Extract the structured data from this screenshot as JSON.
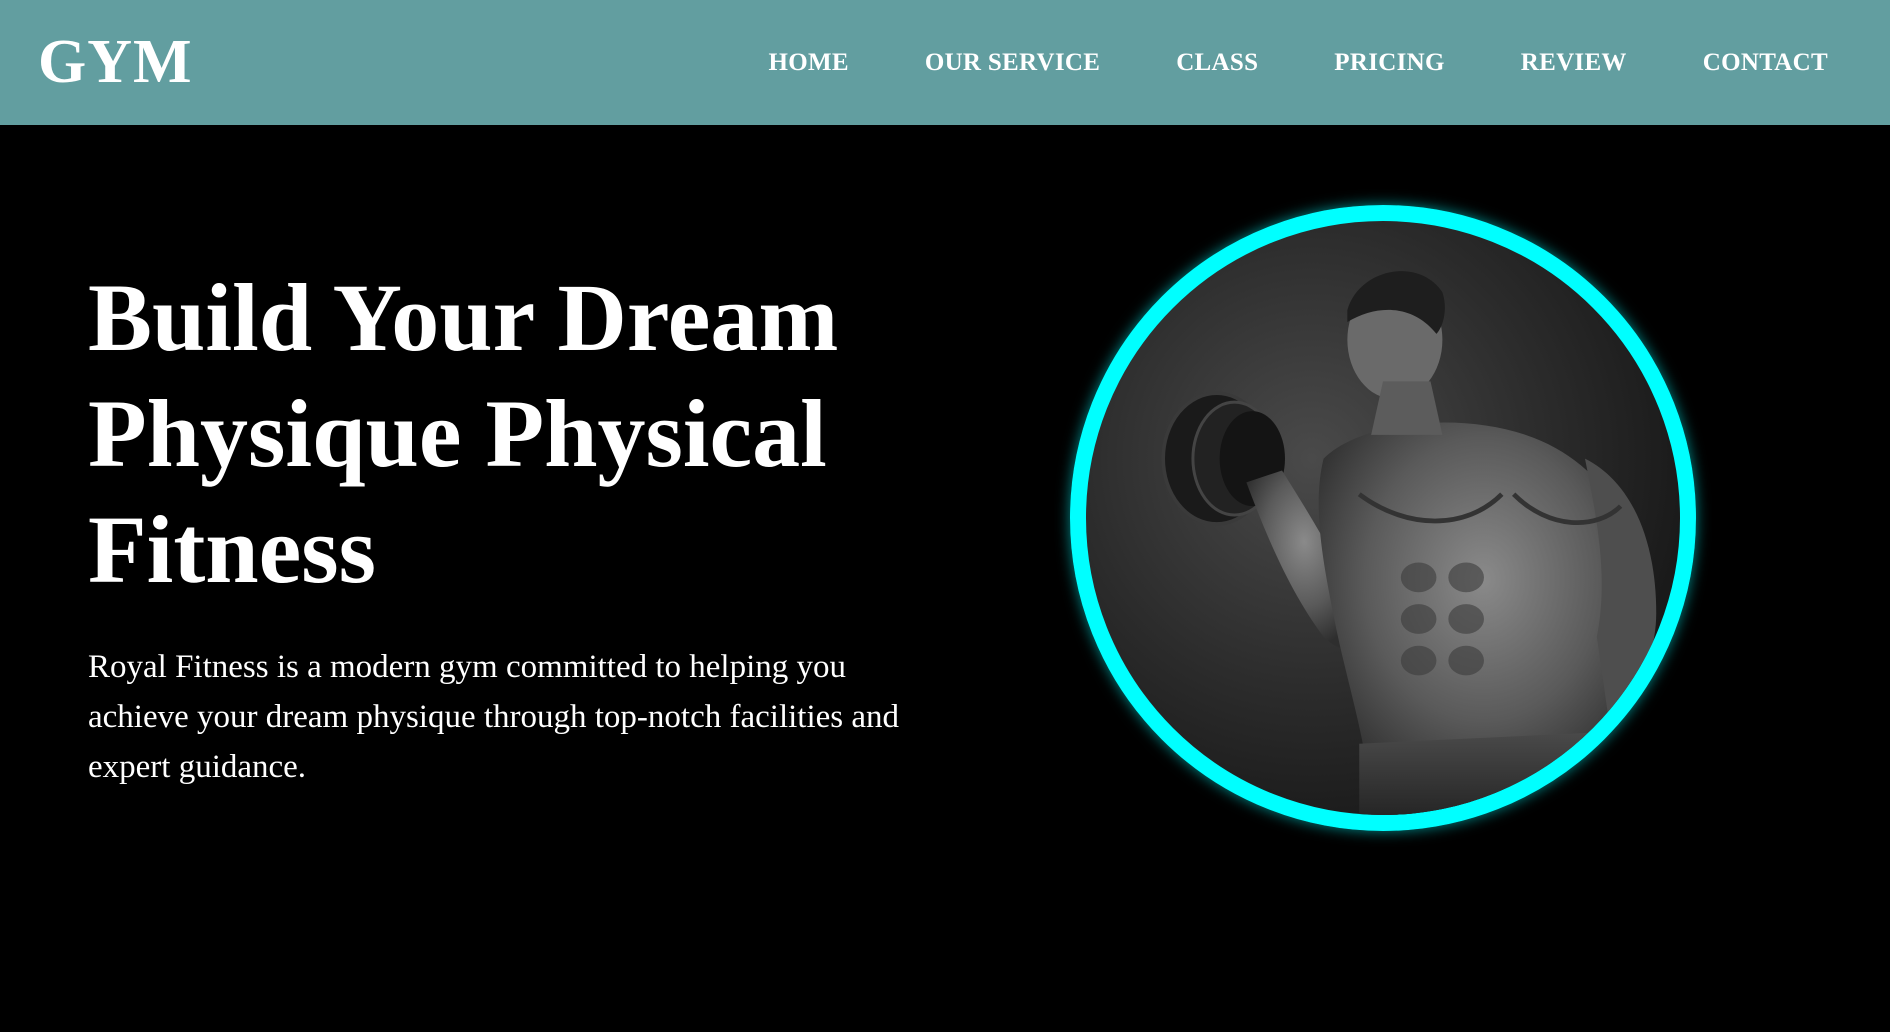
{
  "header": {
    "logo": "GYM",
    "nav": [
      {
        "label": "HOME"
      },
      {
        "label": "OUR SERVICE"
      },
      {
        "label": "CLASS"
      },
      {
        "label": "PRICING"
      },
      {
        "label": "REVIEW"
      },
      {
        "label": "CONTACT"
      }
    ]
  },
  "hero": {
    "title_line1": "Build Your Dream",
    "title_line2": "Physique Physical",
    "title_line3": "Fitness",
    "description": "Royal Fitness is a modern gym committed to helping you achieve your dream physique through top-notch facilities and expert guidance."
  },
  "colors": {
    "header_bg": "#629ea0",
    "page_bg": "#000000",
    "ring_accent": "#00ffff",
    "text": "#ffffff"
  }
}
